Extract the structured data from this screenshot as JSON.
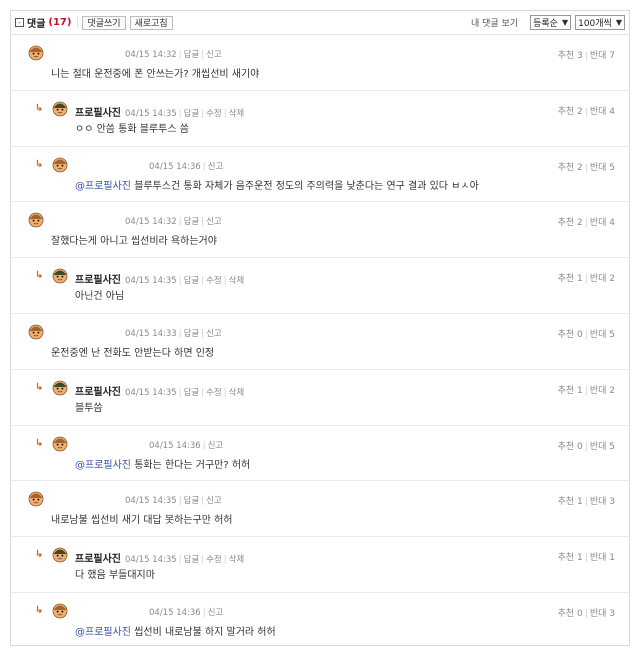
{
  "header": {
    "toggle_glyph": "-",
    "title": "댓글",
    "count": "(17)",
    "write_button": "댓글쓰기",
    "refresh_button": "새로고침",
    "my_comments": "내 댓글 보기",
    "sort_select": "등록순",
    "per_page_select": "100개씩"
  },
  "comments": [
    {
      "type": "top",
      "nick": "",
      "time": "04/15 14:32",
      "actions": [
        "답글",
        "신고"
      ],
      "mention": "",
      "text": "니는 절대 운전중에 폰 안쓰는가? 개씹선비 새기야",
      "up": "추천 3",
      "down": "반대 7"
    },
    {
      "type": "reply",
      "nick": "프로필사진",
      "time": "04/15 14:35",
      "actions": [
        "답글",
        "수정",
        "삭제"
      ],
      "mention": "",
      "text": "ㅇㅇ 안씀 통화 블루투스 씀",
      "up": "추천 2",
      "down": "반대 4"
    },
    {
      "type": "reply",
      "nick": "",
      "time": "04/15 14:36",
      "actions": [
        "신고"
      ],
      "mention": "@프로필사진",
      "text": "블루투스건 통화 자체가 음주운전 정도의 주의력을 낮춘다는 연구 결과 있다 ㅂㅅ아",
      "up": "추천 2",
      "down": "반대 5"
    },
    {
      "type": "top",
      "nick": "",
      "time": "04/15 14:32",
      "actions": [
        "답글",
        "신고"
      ],
      "mention": "",
      "text": "잘했다는게 아니고 씹선비라 욕하는거야",
      "up": "추천 2",
      "down": "반대 4"
    },
    {
      "type": "reply",
      "nick": "프로필사진",
      "time": "04/15 14:35",
      "actions": [
        "답글",
        "수정",
        "삭제"
      ],
      "mention": "",
      "text": "아닌건 아님",
      "up": "추천 1",
      "down": "반대 2"
    },
    {
      "type": "top",
      "nick": "",
      "time": "04/15 14:33",
      "actions": [
        "답글",
        "신고"
      ],
      "mention": "",
      "text": "운전중엔 난 전화도 안받는다 하면 인정",
      "up": "추천 0",
      "down": "반대 5"
    },
    {
      "type": "reply",
      "nick": "프로필사진",
      "time": "04/15 14:35",
      "actions": [
        "답글",
        "수정",
        "삭제"
      ],
      "mention": "",
      "text": "블투씀",
      "up": "추천 1",
      "down": "반대 2"
    },
    {
      "type": "reply",
      "nick": "",
      "time": "04/15 14:36",
      "actions": [
        "신고"
      ],
      "mention": "@프로필사진",
      "text": "통화는 한다는 거구만? 허허",
      "up": "추천 0",
      "down": "반대 5"
    },
    {
      "type": "top",
      "nick": "",
      "time": "04/15 14:35",
      "actions": [
        "답글",
        "신고"
      ],
      "mention": "",
      "text": "내로남불 씹선비 새기 대답 못하는구만 허허",
      "up": "추천 1",
      "down": "반대 3"
    },
    {
      "type": "reply",
      "nick": "프로필사진",
      "time": "04/15 14:35",
      "actions": [
        "답글",
        "수정",
        "삭제"
      ],
      "mention": "",
      "text": "다 했음 부들대지마",
      "up": "추천 1",
      "down": "반대 1"
    },
    {
      "type": "reply",
      "nick": "",
      "time": "04/15 14:36",
      "actions": [
        "신고"
      ],
      "mention": "@프로필사진",
      "text": "씹선비 내로남불 하지 말거라 허허",
      "up": "추천 0",
      "down": "반대 3"
    }
  ]
}
